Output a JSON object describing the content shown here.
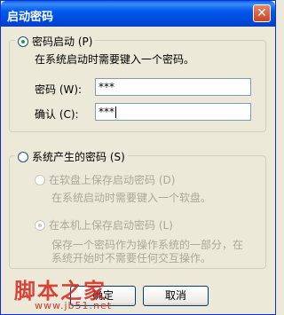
{
  "window": {
    "title": "启动密码",
    "close_glyph": "✕"
  },
  "password_group": {
    "option_label": "密码启动 (P)",
    "description": "在系统启动时需要键入一个密码。",
    "password_label": "密码 (W):",
    "password_value": "***",
    "confirm_label": "确认 (C):",
    "confirm_value": "***"
  },
  "system_group": {
    "option_label": "系统产生的密码 (S)",
    "floppy_option": "在软盘上保存启动密码 (D)",
    "floppy_desc": "在系统启动时需要键入一个软盘。",
    "local_option": "在本机上保存启动密码 (L)",
    "local_desc_line1": "保存一个密码作为操作系统的一部分，在",
    "local_desc_line2": "系统开始时不需要任何交互操作。"
  },
  "buttons": {
    "ok": "确定",
    "cancel": "取消"
  },
  "watermark": {
    "text": "脚本之家",
    "url": "www.jb51.net"
  }
}
